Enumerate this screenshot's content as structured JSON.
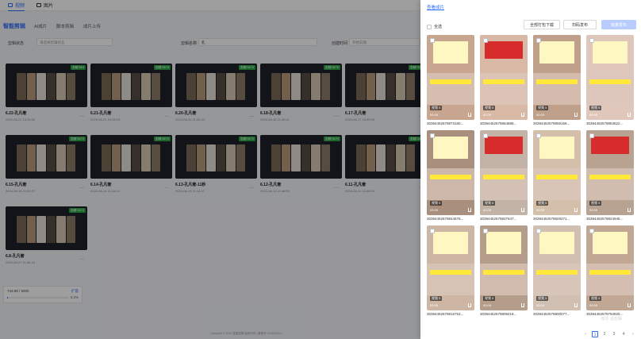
{
  "top_tabs": [
    {
      "label": "视频",
      "active": true
    },
    {
      "label": "图片",
      "active": false
    }
  ],
  "section": {
    "title": "智能剪辑",
    "sub_tabs": [
      "AI成片",
      "脚本剪辑",
      "成片上传"
    ]
  },
  "filters": {
    "type_label": "剪辑状态",
    "type_placeholder": "请选择剪辑状态",
    "name_label": "剪辑名称",
    "name_value": "孔",
    "time_label": "创建时间",
    "time_placeholder": "开始日期"
  },
  "cards": [
    {
      "title": "6.22-孔凡奢",
      "date": "2024-06-22 15:25:08",
      "badge": "剪辑7/8/3"
    },
    {
      "title": "6.21-孔凡奢",
      "date": "2024-06-21 10:08:15",
      "badge": "剪辑7/8/73"
    },
    {
      "title": "6.20-孔凡奢",
      "date": "2024-06-20 11:04:34",
      "badge": "剪辑7/8/73"
    },
    {
      "title": "6.18-孔凡奢",
      "date": "2024-06-18 11:40:41",
      "badge": "剪辑7/8/73"
    },
    {
      "title": "6.17-孔凡奢",
      "date": "2024-06-17 15:45:09",
      "badge": "剪辑7/8/73"
    },
    {
      "title": "6.15-孔凡奢",
      "date": "2024-06-15 10:54:37",
      "badge": "剪辑7/8/73"
    },
    {
      "title": "6.14-孔凡奢",
      "date": "2024-06-14 11:24:22",
      "badge": "剪辑7/8/73"
    },
    {
      "title": "6.13-孔凡奢-11秒",
      "date": "2024-06-13 11:14:07",
      "badge": "剪辑7/8/73"
    },
    {
      "title": "6.12-孔凡奢",
      "date": "2024-06-12 11:48:59",
      "badge": "剪辑7/8/73"
    },
    {
      "title": "6.11-孔凡奢",
      "date": "2024-06-11 10:55:20",
      "badge": "剪辑7/8/73"
    },
    {
      "title": "6.8-孔凡奢",
      "date": "2024-06-07 11:38:15",
      "badge": "剪辑7/8/73"
    }
  ],
  "more_glyph": "···",
  "quota": {
    "text": "743.89 / 5000",
    "button": "扩容",
    "percent_label": "0.2%",
    "fill": 0.002
  },
  "copyright": "Copyright © 2024 智能剪辑 版权所有 | 备案号 2024000001",
  "drawer": {
    "title": "查看成片",
    "select_all": "全选",
    "btn_download_all": "全部打包下载",
    "btn_batch": "扫码发布",
    "btn_primary": "批量发布",
    "tiles": [
      {
        "name": "30394452579873180...",
        "tag": "视频 5",
        "duration": "00:09"
      },
      {
        "name": "30394452579864886...",
        "tag": "视频 5",
        "duration": "00:09"
      },
      {
        "name": "30394452579859158...",
        "tag": "视频 5",
        "duration": "00:09"
      },
      {
        "name": "30394452579853622...",
        "tag": "视频 5",
        "duration": "00:09"
      },
      {
        "name": "30394452579844576...",
        "tag": "视频 5",
        "duration": "00:09"
      },
      {
        "name": "30394452579837647...",
        "tag": "视频 5",
        "duration": "00:09"
      },
      {
        "name": "30394452579829271...",
        "tag": "视频 5",
        "duration": "00:09"
      },
      {
        "name": "30394452579824945...",
        "tag": "视频 5",
        "duration": "00:09"
      },
      {
        "name": "30394452579816753...",
        "tag": "视频 5",
        "duration": "00:09"
      },
      {
        "name": "30394452579808418...",
        "tag": "视频 5",
        "duration": "00:09"
      },
      {
        "name": "30394452579800077...",
        "tag": "视频 5",
        "duration": "00:09"
      },
      {
        "name": "30394452579794925...",
        "tag": "视频 5",
        "duration": "00:09"
      }
    ],
    "pages": [
      "1",
      "2",
      "3",
      "4"
    ],
    "next_glyph": "›",
    "prev_glyph": "‹",
    "watermark": "知乎 @剪辑 "
  }
}
